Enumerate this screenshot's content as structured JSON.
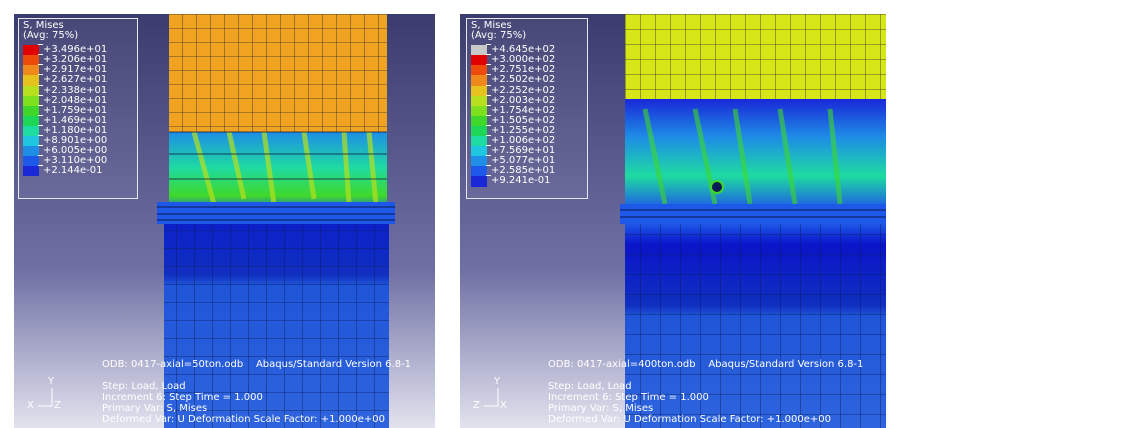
{
  "panels": [
    {
      "legend": {
        "title": "S, Mises",
        "avg": "(Avg: 75%)",
        "values": [
          "+3.496e+01",
          "+3.206e+01",
          "+2.917e+01",
          "+2.627e+01",
          "+2.338e+01",
          "+2.048e+01",
          "+1.759e+01",
          "+1.469e+01",
          "+1.180e+01",
          "+8.901e+00",
          "+6.005e+00",
          "+3.110e+00",
          "+2.144e-01"
        ]
      },
      "odb": "ODB: 0417-axial=50ton.odb",
      "version": "Abaqus/Standard Version 6.8-1",
      "step": "Step: Load, Load",
      "increment": "Increment      6: Step Time =      1.000",
      "primary": "Primary Var: S, Mises",
      "deformed": "Deformed Var: U   Deformation Scale Factor: +1.000e+00",
      "triad": {
        "x": "X",
        "y": "Y",
        "z": "Z"
      },
      "upper_color": "#f0a321"
    },
    {
      "legend": {
        "title": "S, Mises",
        "avg": "(Avg: 75%)",
        "values": [
          "+4.645e+02",
          "+3.000e+02",
          "+2.751e+02",
          "+2.502e+02",
          "+2.252e+02",
          "+2.003e+02",
          "+1.754e+02",
          "+1.505e+02",
          "+1.255e+02",
          "+1.006e+02",
          "+7.569e+01",
          "+5.077e+01",
          "+2.585e+01",
          "+9.241e-01"
        ]
      },
      "odb": "ODB: 0417-axial=400ton.odb",
      "version": "Abaqus/Standard Version 6.8-1",
      "step": "Step: Load, Load",
      "increment": "Increment      6: Step Time =      1.000",
      "primary": "Primary Var: S, Mises",
      "deformed": "Deformed Var: U   Deformation Scale Factor: +1.000e+00",
      "triad": {
        "x": "X",
        "y": "Y",
        "z": "Z"
      },
      "upper_color": "#d6e616"
    }
  ],
  "colors": {
    "legend_scale_1": [
      "#e10000",
      "#ee4b0b",
      "#f0891b",
      "#e6c21d",
      "#b6e01d",
      "#7fe01e",
      "#3fd82a",
      "#1ed655",
      "#1edba1",
      "#1ec6e0",
      "#1e8ee6",
      "#1e58e8",
      "#1a28d8"
    ],
    "legend_scale_2": [
      "#c8c8c8",
      "#e10000",
      "#ee4b0b",
      "#f0891b",
      "#e6c21d",
      "#b6e01d",
      "#7fe01e",
      "#3fd82a",
      "#1ed655",
      "#1edba1",
      "#1ec6e0",
      "#1e8ee6",
      "#1e58e8",
      "#1a28d8"
    ],
    "mesh_blue": "#1f55d8",
    "mesh_dark_blue": "#1030c0"
  }
}
